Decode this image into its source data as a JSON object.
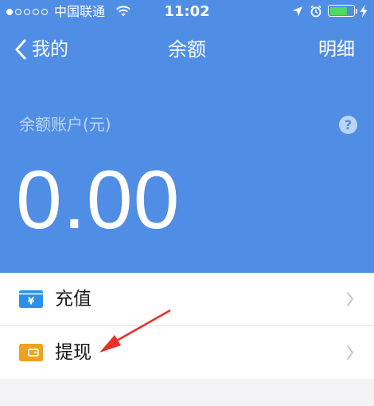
{
  "status_bar": {
    "carrier": "中国联通",
    "time": "11:02",
    "signal_filled": 1,
    "signal_total": 5,
    "battery_level": 0.75,
    "icons": [
      "wifi-icon",
      "location-arrow-icon",
      "alarm-icon",
      "battery-icon",
      "charging-bolt-icon"
    ]
  },
  "nav": {
    "back_label": "我的",
    "title": "余额",
    "right_label": "明细"
  },
  "balance": {
    "account_label": "余额账户(元)",
    "help_icon": "?",
    "amount": "0.00"
  },
  "menu": {
    "items": [
      {
        "label": "充值",
        "icon": "recharge-icon",
        "icon_glyph": "¥",
        "icon_color": "#2a8fe8"
      },
      {
        "label": "提现",
        "icon": "withdraw-wallet-icon",
        "icon_color": "#f0a020"
      }
    ]
  },
  "colors": {
    "header_bg": "#508ee6",
    "page_bg": "#f3f3f5",
    "annotation_arrow": "#e8302a"
  }
}
